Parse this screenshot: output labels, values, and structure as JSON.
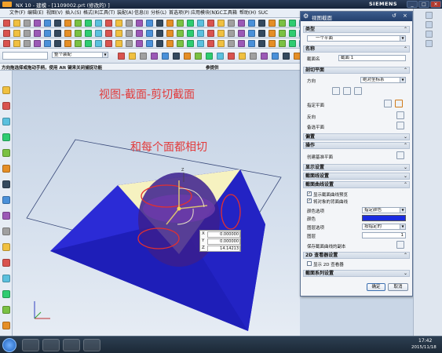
{
  "app": {
    "title": "NX 10 - 建模 - [1109002.prt (修改的) ]",
    "brand": "SIEMENS"
  },
  "menu": [
    "文件(F)",
    "编辑(E)",
    "视图(V)",
    "插入(S)",
    "格式(R)",
    "工具(T)",
    "装配(A)",
    "信息(I)",
    "分析(L)",
    "首选项(P)",
    "应用模块(N)",
    "GC工具箱",
    "帮助(H)",
    "SUC"
  ],
  "toolbar": {
    "selection_filter": "整个装配",
    "cue_line": "方向(帧选对象)选择或拖动手柄(按 Alt 键来关闭捕捉功能)",
    "cue_short": "方向拖选择或拖动手柄，使用 Alt 键来关闭捕捉功能",
    "status_right": "参提供"
  },
  "viewport": {
    "annotation_1": "视图-截面-剪切截面",
    "annotation_2": "和每个面都相切",
    "coords": {
      "x": "0.000000",
      "y": "0.000000",
      "z": "14.14213"
    }
  },
  "dialog": {
    "title": "视图截面",
    "sections": {
      "type": "类型",
      "name": "名称",
      "section_plane": "剖切平面",
      "offset": "偏置",
      "action": "操作",
      "display": "显示设置",
      "section_color": "截面曲线设置",
      "twod": "2D 查看器设置",
      "series": "截面系列设置"
    },
    "type_value": "一个平面",
    "name_label": "截面名",
    "name_value": "截面 1",
    "orientation_label": "方向",
    "orientation_value": "绝对坐标系",
    "specify_plane": "指定平面",
    "reverse": "反向",
    "alt_plane": "备选平面",
    "create_base_plane": "创建基准平面",
    "display_settings": "显示设置",
    "section_setting": "截面线设置",
    "show_section": "显示截面曲线预览",
    "show_interference": "将对象的背面曲线",
    "color_option_label": "颜色选项",
    "color_option_value": "指定颜色",
    "color_label": "颜色",
    "layer_option_label": "图层选项",
    "layer_option_value": "按指定的",
    "layer_label": "图层",
    "layer_value": "1",
    "save_section": "保存截面曲线的副本",
    "show_2d": "显示 2D 查看器",
    "ok": "确定",
    "cancel": "取消",
    "section_color": "#1a2be0"
  },
  "taskbar": {
    "time": "17:42",
    "date": "2015/11/18"
  }
}
